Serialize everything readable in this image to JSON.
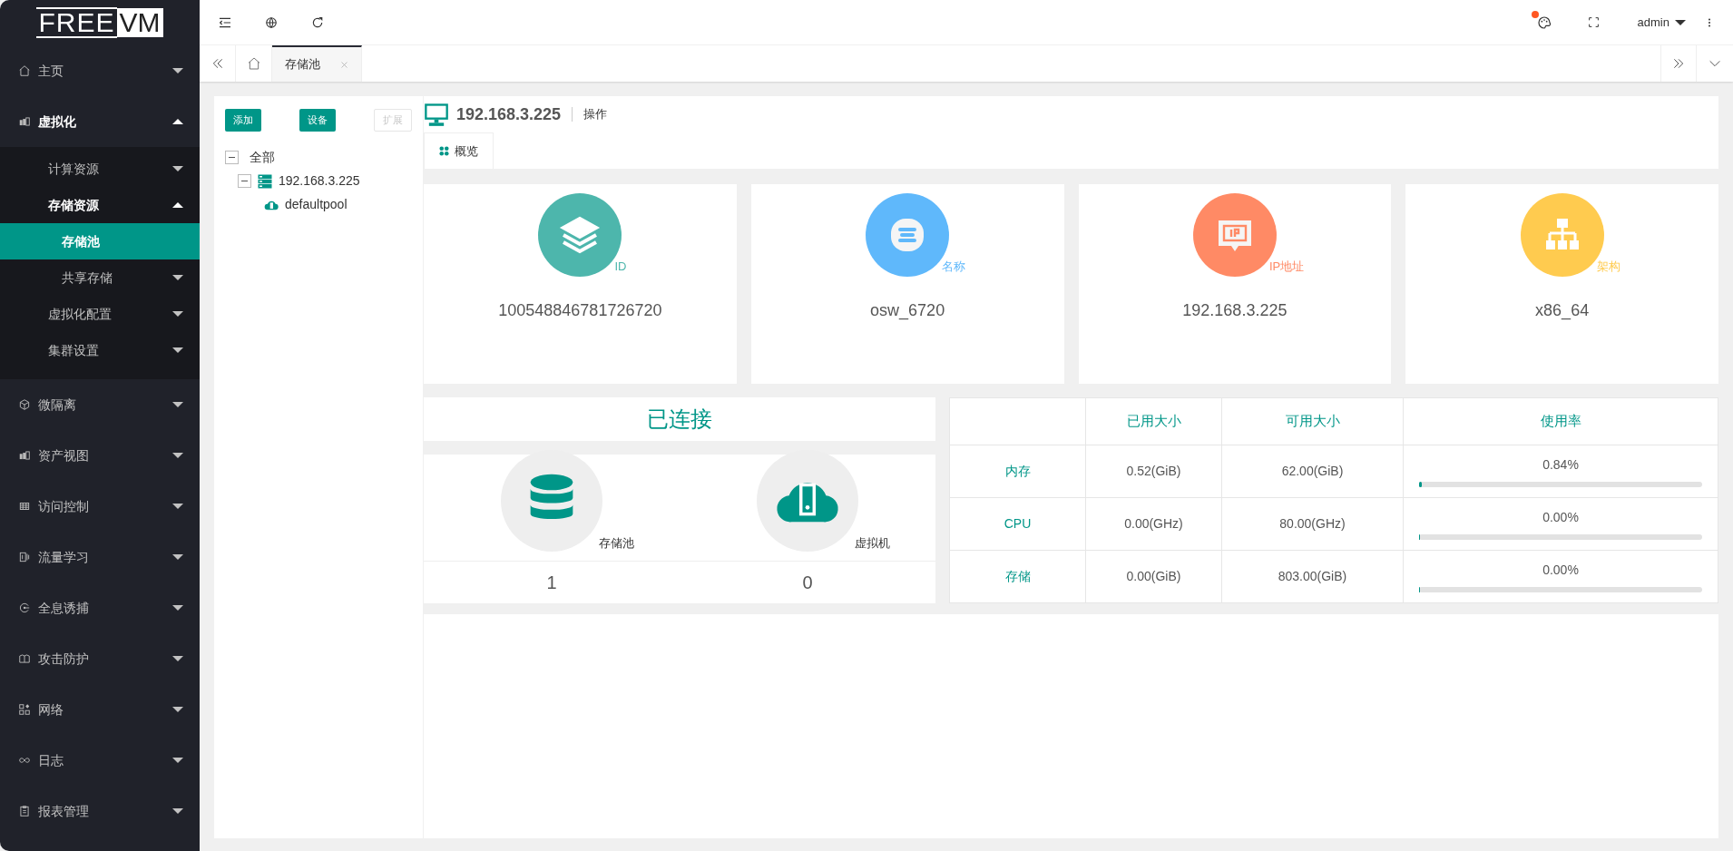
{
  "logo": {
    "left": "FREE",
    "right": "VM"
  },
  "sidebar": {
    "items": [
      {
        "label": "主页",
        "kind": "group",
        "selected": false,
        "expanded": false
      },
      {
        "label": "虚拟化",
        "kind": "group",
        "selected": false,
        "expanded": true,
        "children": [
          {
            "label": "计算资源",
            "kind": "group",
            "selected": false,
            "expanded": false
          },
          {
            "label": "存储资源",
            "kind": "group",
            "selected": false,
            "expanded": true,
            "children": [
              {
                "label": "存储池",
                "kind": "link",
                "selected": true
              },
              {
                "label": "共享存储",
                "kind": "group",
                "selected": false,
                "expanded": false
              }
            ]
          },
          {
            "label": "虚拟化配置",
            "kind": "group",
            "selected": false,
            "expanded": false
          },
          {
            "label": "集群设置",
            "kind": "group",
            "selected": false,
            "expanded": false
          }
        ]
      },
      {
        "label": "微隔离",
        "kind": "group",
        "selected": false,
        "expanded": false
      },
      {
        "label": "资产视图",
        "kind": "group",
        "selected": false,
        "expanded": false
      },
      {
        "label": "访问控制",
        "kind": "group",
        "selected": false,
        "expanded": false
      },
      {
        "label": "流量学习",
        "kind": "group",
        "selected": false,
        "expanded": false
      },
      {
        "label": "全息诱捕",
        "kind": "group",
        "selected": false,
        "expanded": false
      },
      {
        "label": "攻击防护",
        "kind": "group",
        "selected": false,
        "expanded": false
      },
      {
        "label": "网络",
        "kind": "group",
        "selected": false,
        "expanded": false
      },
      {
        "label": "日志",
        "kind": "group",
        "selected": false,
        "expanded": false
      },
      {
        "label": "报表管理",
        "kind": "group",
        "selected": false,
        "expanded": false
      }
    ]
  },
  "header": {
    "user": "admin",
    "notification": true
  },
  "page_tabs": [
    {
      "label": "存储池",
      "selected": true
    }
  ],
  "left_panel": {
    "buttons": [
      {
        "label": "添加",
        "disabled": false
      },
      {
        "label": "设备",
        "disabled": false
      },
      {
        "label": "扩展",
        "disabled": true
      }
    ],
    "tree": [
      {
        "label": "全部",
        "expanded": true,
        "children": [
          {
            "label": "192.168.3.225",
            "expanded": true,
            "children": [
              {
                "label": "defaultpool"
              }
            ]
          }
        ]
      }
    ]
  },
  "host": {
    "title": "192.168.3.225",
    "action": "操作"
  },
  "detail_tabs": [
    {
      "label": "概览",
      "selected": true
    }
  ],
  "info_cards": [
    {
      "label": "ID",
      "value": "100548846781726720",
      "color": "#4db6ac"
    },
    {
      "label": "名称",
      "value": "osw_6720",
      "color": "#5fb8fb"
    },
    {
      "label": "IP地址",
      "value": "192.168.3.225",
      "color": "#ff8a65"
    },
    {
      "label": "架构",
      "value": "x86_64",
      "color": "#ffcb4f"
    }
  ],
  "status": "已连接",
  "counts": [
    {
      "label": "存储池",
      "value": "1"
    },
    {
      "label": "虚拟机",
      "value": "0"
    }
  ],
  "usage_table": {
    "columns": [
      "已用大小",
      "可用大小",
      "使用率"
    ],
    "rows": [
      {
        "name": "内存",
        "used": "0.52(GiB)",
        "available": "62.00(GiB)",
        "rate": "0.84%",
        "level": 0.0084
      },
      {
        "name": "CPU",
        "used": "0.00(GHz)",
        "available": "80.00(GHz)",
        "rate": "0.00%",
        "level": 0
      },
      {
        "name": "存储",
        "used": "0.00(GiB)",
        "available": "803.00(GiB)",
        "rate": "0.00%",
        "level": 0
      }
    ]
  }
}
